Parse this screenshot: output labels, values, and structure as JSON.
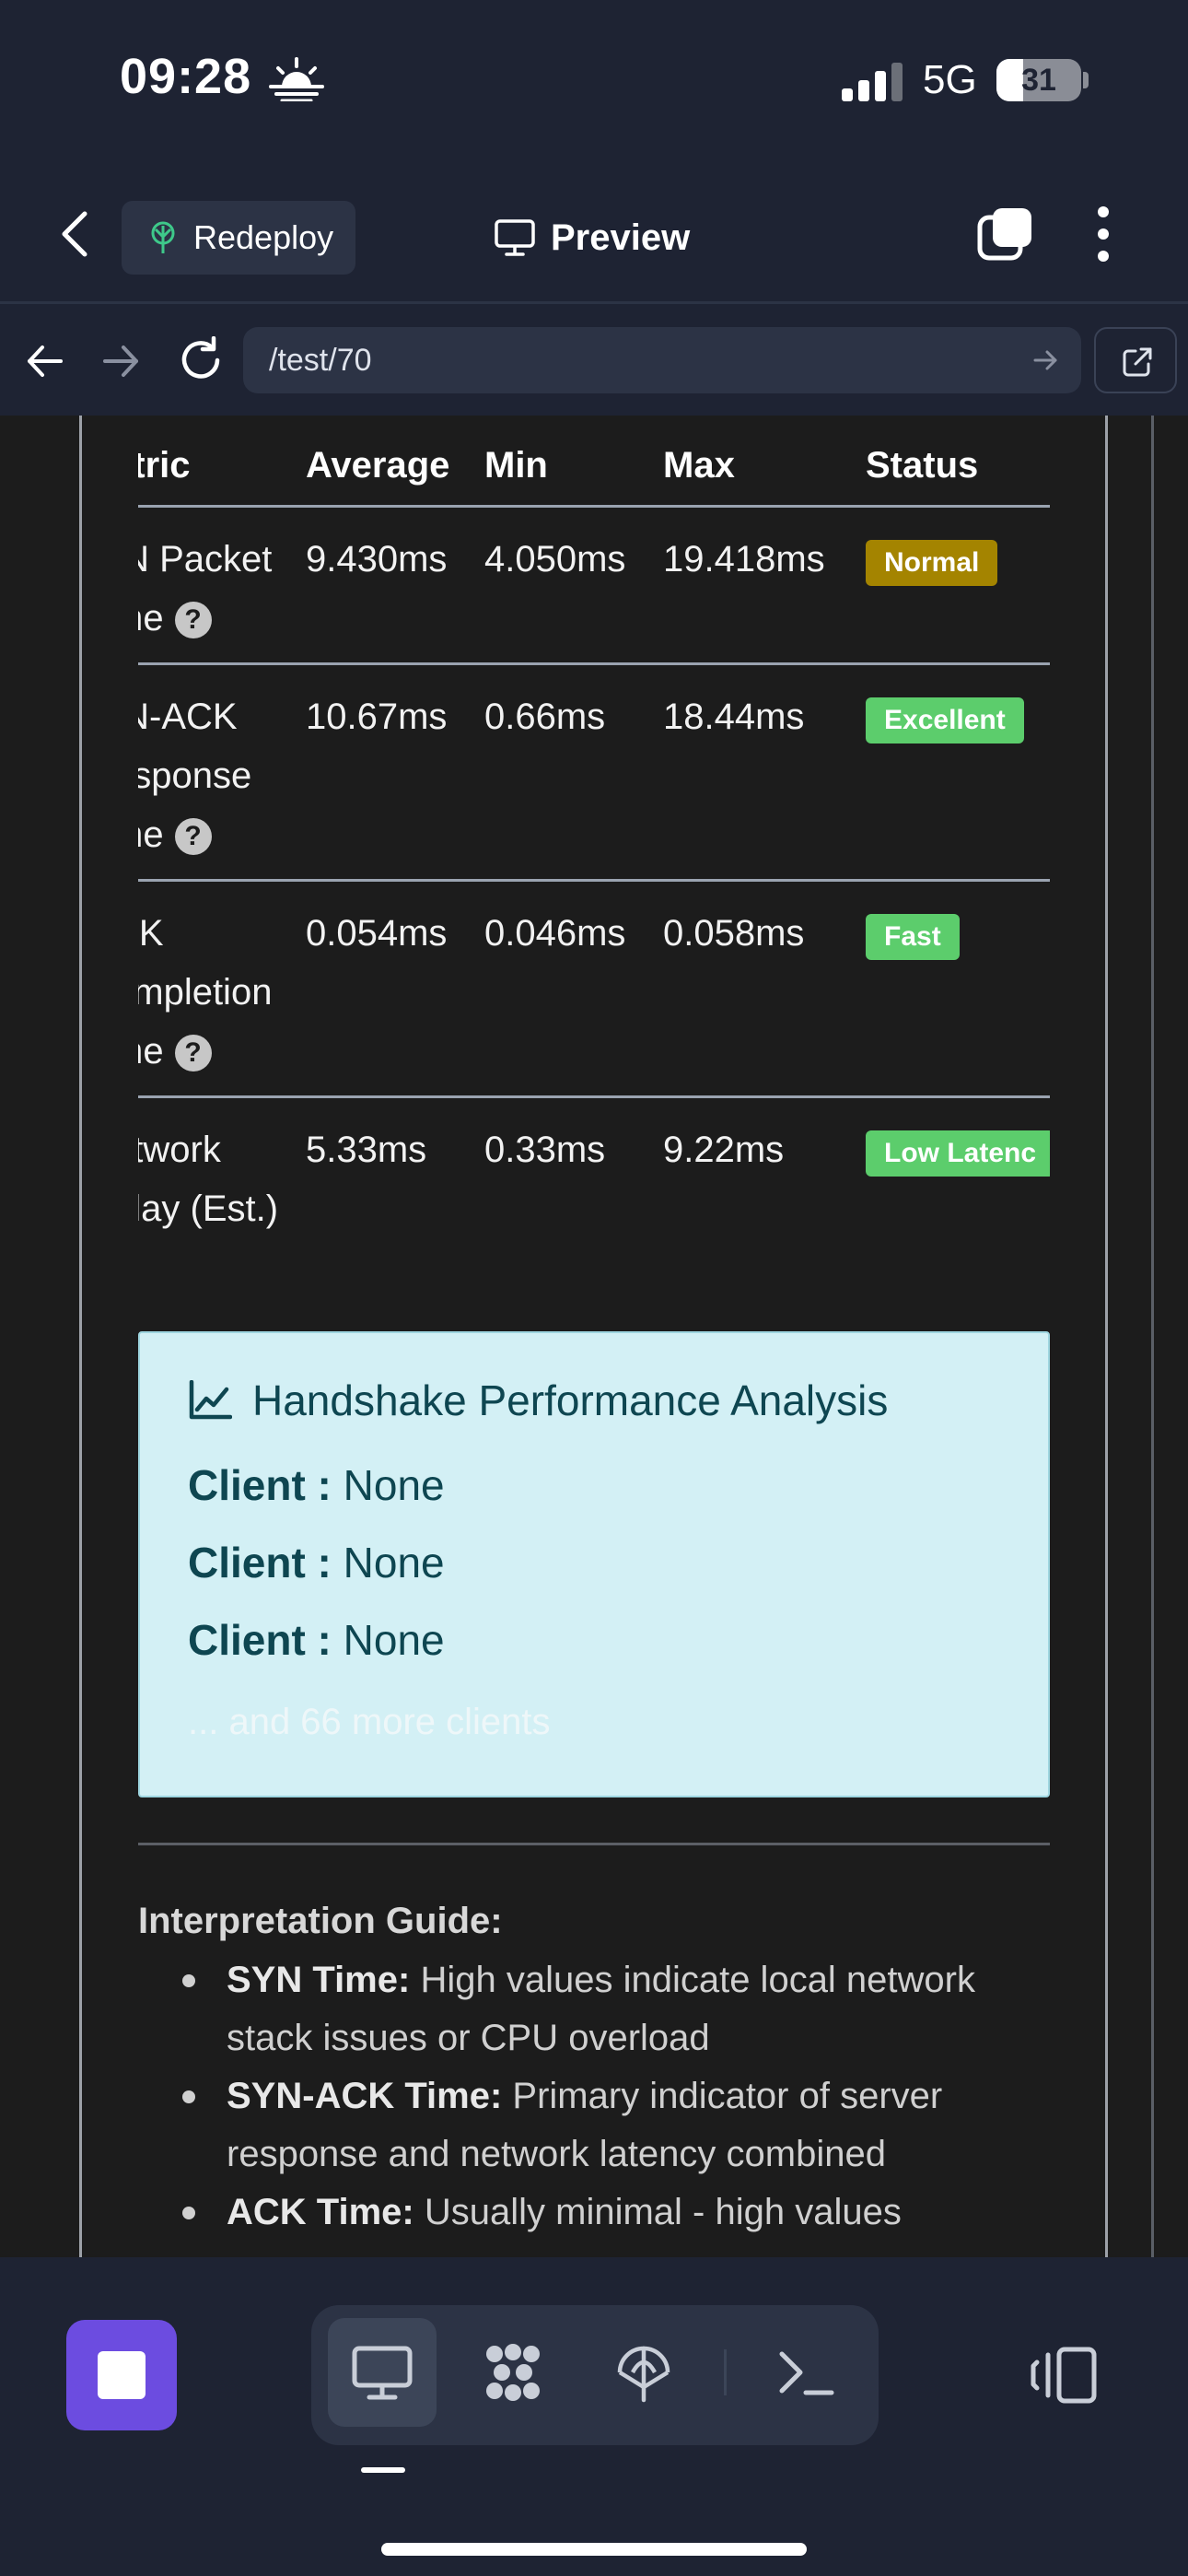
{
  "status_bar": {
    "time": "09:28",
    "network": "5G",
    "battery": "31",
    "battery_level": 0.31
  },
  "header": {
    "back": "back",
    "redeploy_label": "Redeploy",
    "title": "Preview"
  },
  "browser": {
    "url": "/test/70"
  },
  "table": {
    "headers": [
      "etric",
      "Average",
      "Min",
      "Max",
      "Status"
    ],
    "rows": [
      {
        "metric_lines": [
          "/N Packet",
          "me"
        ],
        "average": "9.430ms",
        "min": "4.050ms",
        "max": "19.418ms",
        "status": "Normal",
        "status_color": "#a48400",
        "help": "?"
      },
      {
        "metric_lines": [
          "/N-ACK",
          "esponse",
          "me"
        ],
        "average": "10.67ms",
        "min": "0.66ms",
        "max": "18.44ms",
        "status": "Excellent",
        "status_color": "#5ccd6c",
        "help": "?"
      },
      {
        "metric_lines": [
          "CK",
          "ompletion",
          "me"
        ],
        "average": "0.054ms",
        "min": "0.046ms",
        "max": "0.058ms",
        "status": "Fast",
        "status_color": "#5ccd6c",
        "help": "?"
      },
      {
        "metric_lines": [
          "etwork",
          "elay (Est.)"
        ],
        "average": "5.33ms",
        "min": "0.33ms",
        "max": "9.22ms",
        "status": "Low Latenc",
        "status_color": "#5ccd6c"
      }
    ]
  },
  "analysis": {
    "title": "Handshake Performance Analysis",
    "clients": [
      {
        "label": "Client :",
        "value": "None"
      },
      {
        "label": "Client :",
        "value": "None"
      },
      {
        "label": "Client :",
        "value": "None"
      }
    ],
    "more": "... and 66 more clients"
  },
  "guide": {
    "title": "Interpretation Guide:",
    "items": [
      {
        "term": "SYN Time:",
        "text": "High values indicate local network stack issues or CPU overload"
      },
      {
        "term": "SYN-ACK Time:",
        "text": "Primary indicator of server response and network latency combined"
      },
      {
        "term": "ACK Time:",
        "text": "Usually minimal - high values"
      }
    ]
  },
  "colors": {
    "accent": "#6c4ce0",
    "background": "#1e2333",
    "content_bg": "#1c1c1c",
    "analysis_bg": "#d3f0f5"
  },
  "toolbar": {
    "icons": [
      "stop-icon",
      "desktop-icon",
      "dots-grid-icon",
      "antenna-icon",
      "terminal-icon",
      "panel-toggle-icon"
    ]
  }
}
